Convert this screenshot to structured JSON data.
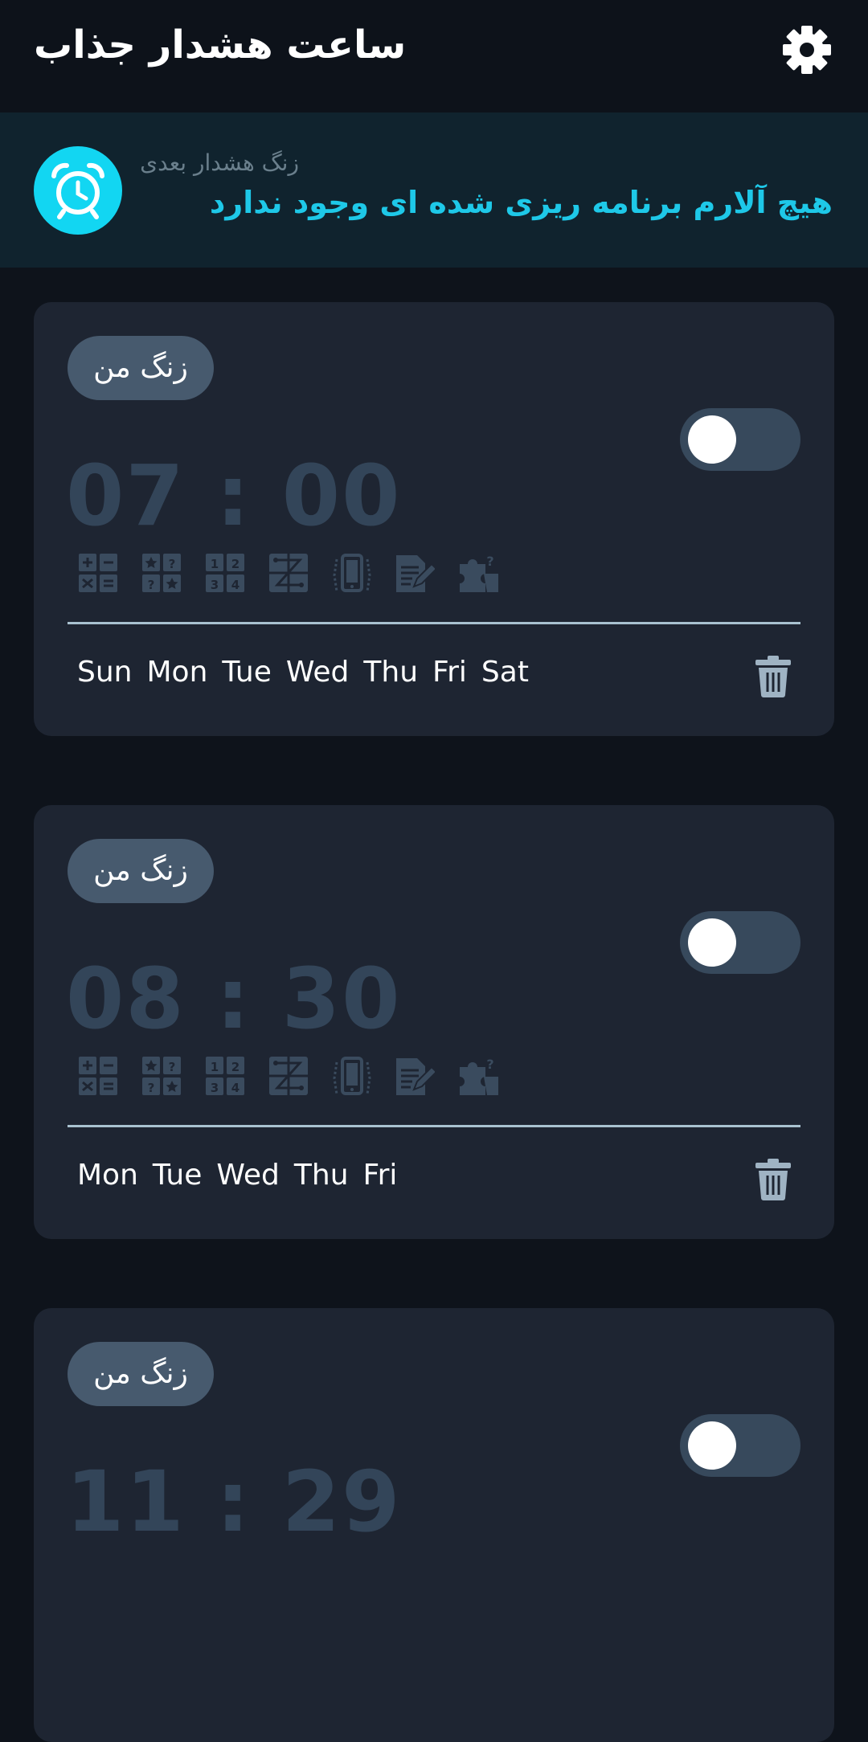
{
  "header": {
    "title": "ساعت هشدار جذاب",
    "settings_icon": "gear-icon"
  },
  "next_alarm": {
    "icon": "alarm-clock-icon",
    "label": "زنگ هشدار بعدی",
    "message": "هیچ آلارم برنامه ریزی شده ای وجود ندارد",
    "accent_color": "#1ec8e8"
  },
  "alarms": [
    {
      "name": "زنگ من",
      "time": "07 : 00",
      "enabled": false,
      "days": [
        "Sun",
        "Mon",
        "Tue",
        "Wed",
        "Thu",
        "Fri",
        "Sat"
      ],
      "task_icons": [
        "math-icon",
        "memory-icon",
        "sequence-icon",
        "pattern-icon",
        "shake-icon",
        "typing-icon",
        "puzzle-icon"
      ]
    },
    {
      "name": "زنگ من",
      "time": "08 : 30",
      "enabled": false,
      "days": [
        "Mon",
        "Tue",
        "Wed",
        "Thu",
        "Fri"
      ],
      "task_icons": [
        "math-icon",
        "memory-icon",
        "sequence-icon",
        "pattern-icon",
        "shake-icon",
        "typing-icon",
        "puzzle-icon"
      ]
    },
    {
      "name": "زنگ من",
      "time": "11 : 29",
      "enabled": false
    }
  ]
}
